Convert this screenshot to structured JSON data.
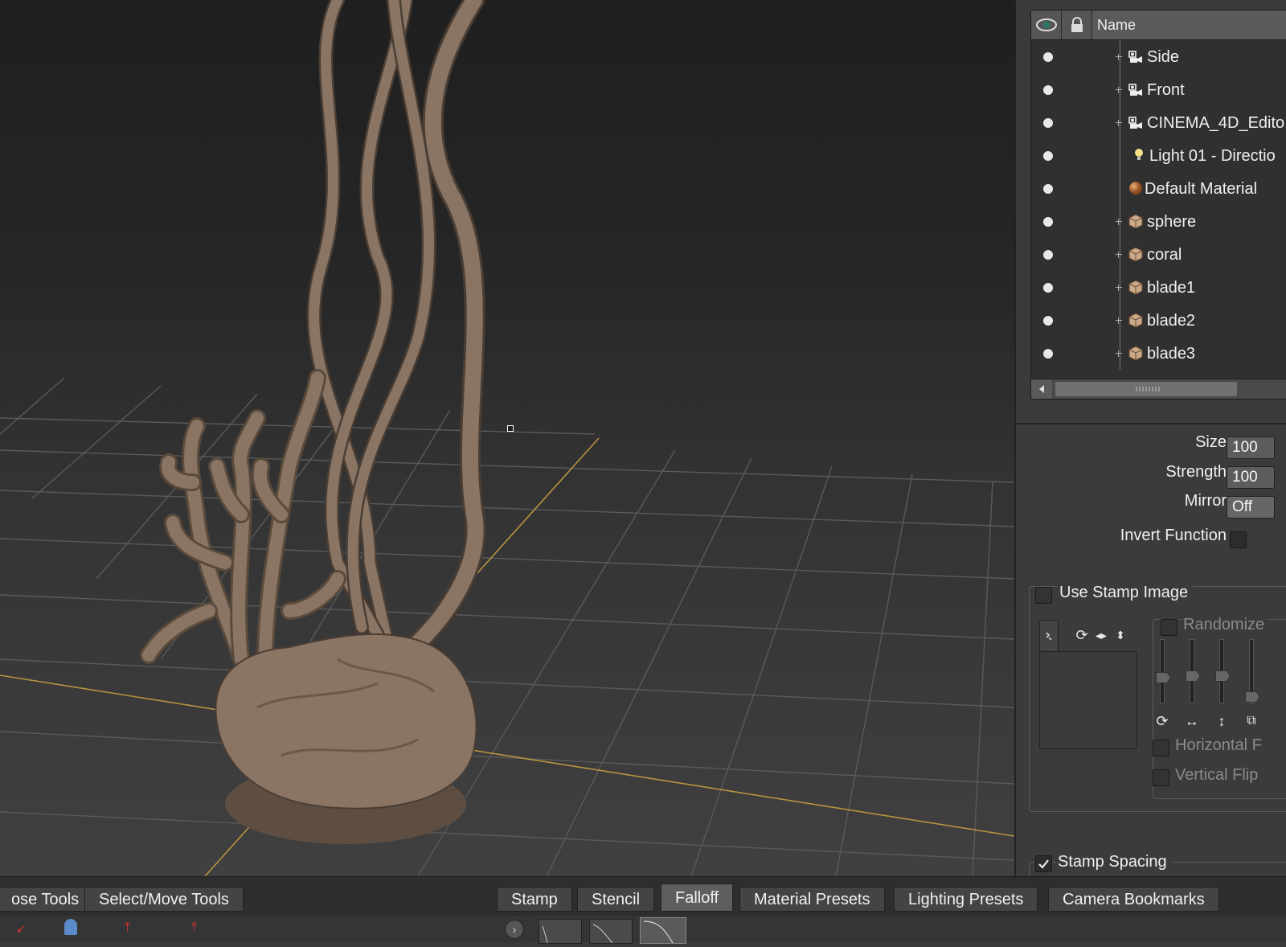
{
  "outliner": {
    "header": {
      "name_label": "Name",
      "eye_icon": "eye-icon",
      "lock_icon": "lock-icon"
    },
    "items": [
      {
        "label": "Side",
        "icon": "camera-icon",
        "expandable": true
      },
      {
        "label": "Front",
        "icon": "camera-icon",
        "expandable": true
      },
      {
        "label": "CINEMA_4D_Edito",
        "icon": "camera-icon",
        "expandable": true
      },
      {
        "label": "Light 01 - Directio",
        "icon": "light-bulb-icon",
        "expandable": false
      },
      {
        "label": "Default Material",
        "icon": "material-sphere-icon",
        "expandable": false
      },
      {
        "label": "sphere",
        "icon": "mesh-cube-icon",
        "expandable": true
      },
      {
        "label": "coral",
        "icon": "mesh-cube-icon",
        "expandable": true
      },
      {
        "label": "blade1",
        "icon": "mesh-cube-icon",
        "expandable": true
      },
      {
        "label": "blade2",
        "icon": "mesh-cube-icon",
        "expandable": true
      },
      {
        "label": "blade3",
        "icon": "mesh-cube-icon",
        "expandable": true
      }
    ]
  },
  "brush": {
    "size_label": "Size",
    "size_value": "100",
    "strength_label": "Strength",
    "strength_value": "100",
    "mirror_label": "Mirror",
    "mirror_value": "Off",
    "invert_label": "Invert Function"
  },
  "stamp": {
    "use_stamp_label": "Use Stamp Image",
    "randomize_label": "Randomize",
    "horizontal_flip_label": "Horizontal F",
    "vertical_flip_label": "Vertical Flip",
    "stamp_spacing_label": "Stamp Spacing",
    "stamp_spacing_checked": true
  },
  "bottom": {
    "left_tabs": [
      "ose Tools",
      "Select/Move Tools"
    ],
    "right_tabs": [
      "Stamp",
      "Stencil",
      "Falloff",
      "Material Presets",
      "Lighting Presets",
      "Camera Bookmarks"
    ],
    "active_tab": "Falloff"
  },
  "colors": {
    "mesh": "#8a7565",
    "grid_line": "#5a5a5a",
    "axis_line": "#b89440"
  }
}
